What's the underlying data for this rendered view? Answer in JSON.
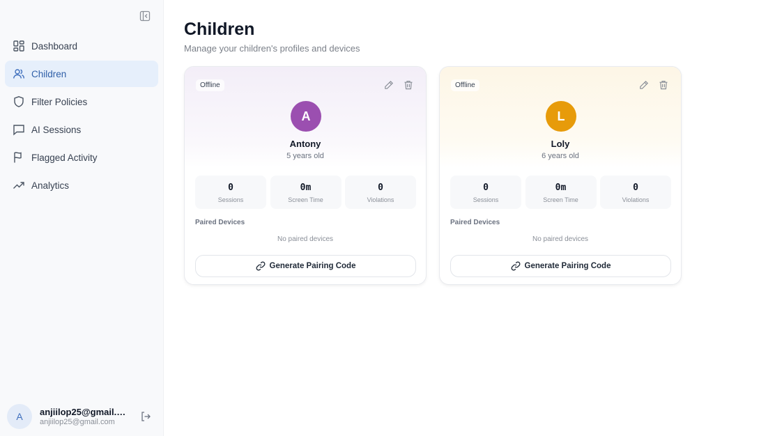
{
  "sidebar": {
    "items": [
      {
        "label": "Dashboard",
        "icon": "dashboard-icon",
        "active": false
      },
      {
        "label": "Children",
        "icon": "users-icon",
        "active": true
      },
      {
        "label": "Filter Policies",
        "icon": "shield-icon",
        "active": false
      },
      {
        "label": "AI Sessions",
        "icon": "chat-icon",
        "active": false
      },
      {
        "label": "Flagged Activity",
        "icon": "flag-icon",
        "active": false
      },
      {
        "label": "Analytics",
        "icon": "trending-icon",
        "active": false
      }
    ],
    "user": {
      "initial": "A",
      "name": "anjiilop25@gmail.c...",
      "email": "anjiilop25@gmail.com"
    }
  },
  "page": {
    "title": "Children",
    "subtitle": "Manage your children's profiles and devices"
  },
  "children": [
    {
      "status": "Offline",
      "initial": "A",
      "name": "Antony",
      "age": "5 years old",
      "avatar_color": "#9b4fb0",
      "stats": [
        {
          "value": "0",
          "label": "Sessions"
        },
        {
          "value": "0m",
          "label": "Screen Time"
        },
        {
          "value": "0",
          "label": "Violations"
        }
      ],
      "paired_label": "Paired Devices",
      "no_devices": "No paired devices",
      "button_label": "Generate Pairing Code"
    },
    {
      "status": "Offline",
      "initial": "L",
      "name": "Loly",
      "age": "6 years old",
      "avatar_color": "#e79b0a",
      "stats": [
        {
          "value": "0",
          "label": "Sessions"
        },
        {
          "value": "0m",
          "label": "Screen Time"
        },
        {
          "value": "0",
          "label": "Violations"
        }
      ],
      "paired_label": "Paired Devices",
      "no_devices": "No paired devices",
      "button_label": "Generate Pairing Code"
    }
  ]
}
